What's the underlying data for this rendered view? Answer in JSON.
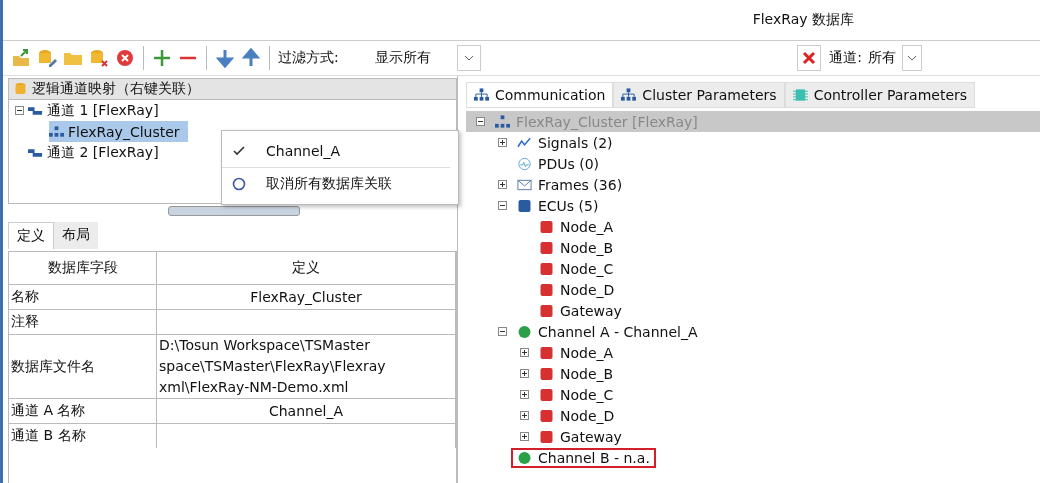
{
  "window": {
    "title": "FlexRay 数据库"
  },
  "toolbar": {
    "filter_label": "过滤方式:",
    "filter_value": "显示所有",
    "channel_label": "通道:",
    "channel_value": "所有"
  },
  "mapping": {
    "header": "逻辑通道映射（右键关联）",
    "items": [
      {
        "label": "通道 1 [FlexRay]",
        "expanded": true,
        "selected": false,
        "children": [
          {
            "label": "FlexRay_Cluster",
            "selected": true
          }
        ]
      },
      {
        "label": "通道 2 [FlexRay]",
        "selected": false
      }
    ]
  },
  "context_menu": [
    {
      "label": "Channel_A",
      "kind": "check",
      "checked": true
    },
    {
      "label": "取消所有数据库关联",
      "kind": "radio",
      "checked": false
    }
  ],
  "def_tabs": [
    {
      "label": "定义",
      "selected": true
    },
    {
      "label": "布局",
      "selected": false
    }
  ],
  "table": {
    "columns": [
      "数据库字段",
      "定义"
    ],
    "rows": [
      [
        "名称",
        "FlexRay_Cluster"
      ],
      [
        "注释",
        ""
      ],
      [
        "数据库文件名",
        "D:\\Tosun Workspace\\TSMaster space\\TSMaster\\FlexRay\\Flexray xml\\FlexRay-NM-Demo.xml"
      ],
      [
        "通道 A 名称",
        "Channel_A"
      ],
      [
        "通道 B 名称",
        ""
      ]
    ]
  },
  "right_tabs": [
    {
      "label": "Communication",
      "kind": "tree",
      "selected": true
    },
    {
      "label": "Cluster Parameters",
      "kind": "tree",
      "selected": false
    },
    {
      "label": "Controller Parameters",
      "kind": "chip",
      "selected": false
    }
  ],
  "tree": [
    {
      "label": "FlexRay_Cluster [FlexRay]",
      "kind": "cluster",
      "expanded": true,
      "selected": true,
      "outlined": false,
      "children": [
        {
          "label": "Signals (2)",
          "kind": "signal",
          "expanded": false,
          "selected": false,
          "outlined": false
        },
        {
          "label": "PDUs (0)",
          "kind": "pdu",
          "selected": false,
          "outlined": false
        },
        {
          "label": "Frames (36)",
          "kind": "frame",
          "expanded": false,
          "selected": false,
          "outlined": false
        },
        {
          "label": "ECUs (5)",
          "kind": "ecus",
          "expanded": true,
          "selected": false,
          "outlined": false,
          "children": [
            {
              "label": "Node_A",
              "kind": "node",
              "selected": false,
              "outlined": false
            },
            {
              "label": "Node_B",
              "kind": "node",
              "selected": false,
              "outlined": false
            },
            {
              "label": "Node_C",
              "kind": "node",
              "selected": false,
              "outlined": false
            },
            {
              "label": "Node_D",
              "kind": "node",
              "selected": false,
              "outlined": false
            },
            {
              "label": "Gateway",
              "kind": "node",
              "selected": false,
              "outlined": false
            }
          ]
        },
        {
          "label": "Channel A - Channel_A",
          "kind": "channel",
          "expanded": true,
          "selected": false,
          "outlined": false,
          "children": [
            {
              "label": "Node_A",
              "kind": "node",
              "expanded": false,
              "selected": false,
              "outlined": false
            },
            {
              "label": "Node_B",
              "kind": "node",
              "expanded": false,
              "selected": false,
              "outlined": false
            },
            {
              "label": "Node_C",
              "kind": "node",
              "expanded": false,
              "selected": false,
              "outlined": false
            },
            {
              "label": "Node_D",
              "kind": "node",
              "expanded": false,
              "selected": false,
              "outlined": false
            },
            {
              "label": "Gateway",
              "kind": "node",
              "expanded": false,
              "selected": false,
              "outlined": false
            }
          ]
        },
        {
          "label": "Channel B - n.a.",
          "kind": "channel",
          "selected": false,
          "outlined": true
        }
      ]
    }
  ]
}
